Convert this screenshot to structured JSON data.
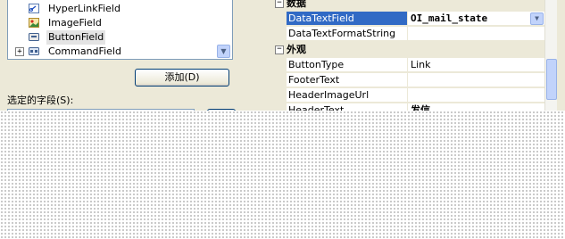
{
  "field_list": {
    "items": [
      {
        "label": "HyperLinkField",
        "icon": "hyperlink-field-icon",
        "expandable": false,
        "selected": false
      },
      {
        "label": "ImageField",
        "icon": "image-field-icon",
        "expandable": false,
        "selected": false
      },
      {
        "label": "ButtonField",
        "icon": "button-field-icon",
        "expandable": false,
        "selected": true
      },
      {
        "label": "CommandField",
        "icon": "command-field-icon",
        "expandable": true,
        "expander": "+",
        "selected": false
      }
    ]
  },
  "add_button": {
    "label": "添加(D)"
  },
  "selected_fields": {
    "label": "选定的字段(S):"
  },
  "property_grid": {
    "categories": [
      {
        "title": "数据",
        "toggle": "⊟"
      },
      {
        "title": "外观",
        "toggle": "⊟"
      }
    ],
    "data_rows": [
      {
        "name": "DataTextField",
        "value": "OI_mail_state",
        "highlighted": true
      },
      {
        "name": "DataTextFormatString",
        "value": ""
      }
    ],
    "appearance_rows": [
      {
        "name": "ButtonType",
        "value": "Link"
      },
      {
        "name": "FooterText",
        "value": ""
      },
      {
        "name": "HeaderImageUrl",
        "value": ""
      },
      {
        "name": "HeaderText",
        "value": "发信"
      }
    ]
  },
  "colors": {
    "highlight": "#316ac5",
    "dialog_bg": "#ece9d8",
    "border": "#7f9db9"
  }
}
